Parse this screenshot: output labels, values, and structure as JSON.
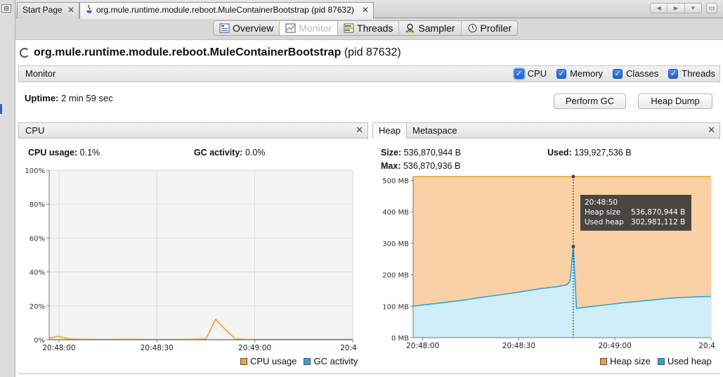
{
  "tabs": [
    {
      "label": "Start Page"
    },
    {
      "label": "org.mule.runtime.module.reboot.MuleContainerBootstrap (pid 87632)"
    }
  ],
  "subnav": [
    {
      "label": "Overview",
      "icon": "overview-icon"
    },
    {
      "label": "Monitor",
      "icon": "monitor-icon"
    },
    {
      "label": "Threads",
      "icon": "threads-icon"
    },
    {
      "label": "Sampler",
      "icon": "sampler-icon"
    },
    {
      "label": "Profiler",
      "icon": "profiler-icon"
    }
  ],
  "process": {
    "name": "org.mule.runtime.module.reboot.MuleContainerBootstrap",
    "pid": "(pid 87632)"
  },
  "monitor": {
    "label": "Monitor",
    "checks": [
      {
        "label": "CPU",
        "checked": true
      },
      {
        "label": "Memory",
        "checked": true
      },
      {
        "label": "Classes",
        "checked": true
      },
      {
        "label": "Threads",
        "checked": true
      }
    ],
    "uptime_label": "Uptime:",
    "uptime_value": "2 min 59 sec",
    "perform_gc": "Perform GC",
    "heap_dump": "Heap Dump"
  },
  "cpu_panel": {
    "title": "CPU",
    "cpu_usage_label": "CPU usage:",
    "cpu_usage_value": "0.1%",
    "gc_label": "GC activity:",
    "gc_value": "0.0%",
    "legend": [
      {
        "label": "CPU usage",
        "color": "#f0a030"
      },
      {
        "label": "GC activity",
        "color": "#2ea3d8"
      }
    ]
  },
  "heap_panel": {
    "tabs": [
      "Heap",
      "Metaspace"
    ],
    "size_label": "Size:",
    "size_value": "536,870,944 B",
    "max_label": "Max:",
    "max_value": "536,870,936 B",
    "used_label": "Used:",
    "used_value": "139,927,536 B",
    "tooltip": {
      "time": "20:48:50",
      "heap_size_label": "Heap size",
      "heap_size_value": "536,870,944 B",
      "used_heap_label": "Used heap",
      "used_heap_value": "302,981,112 B"
    },
    "legend": [
      {
        "label": "Heap size",
        "color": "#f0a030"
      },
      {
        "label": "Used heap",
        "color": "#2ea3d8"
      }
    ]
  },
  "chart_data": [
    {
      "type": "line",
      "name": "cpu",
      "ylim": [
        0,
        100
      ],
      "yticks": [
        "0%",
        "20%",
        "40%",
        "60%",
        "80%",
        "100%"
      ],
      "xticks": [
        "20:48:00",
        "20:48:30",
        "20:49:00",
        "20:4"
      ],
      "x_seconds": [
        0,
        3,
        6,
        9,
        12,
        15,
        18,
        21,
        24,
        27,
        30,
        33,
        36,
        39,
        42,
        45,
        48,
        51,
        54,
        57,
        60,
        63,
        66,
        69,
        72,
        75,
        78,
        81,
        84,
        87,
        90,
        93
      ],
      "series": [
        {
          "name": "CPU usage",
          "color": "#f0a030",
          "values": [
            1,
            2,
            0.5,
            0.3,
            0.2,
            0.2,
            0.2,
            0.2,
            0.3,
            0.2,
            0.2,
            0.2,
            0.2,
            0.2,
            0.2,
            0.3,
            0.5,
            12,
            6,
            0.5,
            0.2,
            0.2,
            0.2,
            0.2,
            0.2,
            0.2,
            0.2,
            0.2,
            0.2,
            0.2,
            0.2,
            0.2
          ]
        },
        {
          "name": "GC activity",
          "color": "#2ea3d8",
          "values": [
            0,
            0,
            0,
            0,
            0,
            0,
            0,
            0,
            0,
            0,
            0,
            0,
            0,
            0,
            0,
            0,
            0,
            0,
            0,
            0,
            0,
            0,
            0,
            0,
            0,
            0,
            0,
            0,
            0,
            0,
            0,
            0
          ]
        }
      ]
    },
    {
      "type": "area",
      "name": "heap",
      "ylim": [
        0,
        512
      ],
      "yunits": "MB",
      "yticks": [
        "0 MB",
        "100 MB",
        "200 MB",
        "300 MB",
        "400 MB",
        "500 MB"
      ],
      "xticks": [
        "20:48:00",
        "20:48:30",
        "20:49:00",
        "20:4"
      ],
      "x_seconds": [
        0,
        5,
        10,
        15,
        20,
        25,
        30,
        35,
        40,
        45,
        48,
        49,
        50,
        51,
        55,
        60,
        65,
        70,
        75,
        80,
        85,
        90,
        93
      ],
      "series": [
        {
          "name": "Heap size",
          "color": "#f0a030",
          "values": [
            512,
            512,
            512,
            512,
            512,
            512,
            512,
            512,
            512,
            512,
            512,
            512,
            512,
            512,
            512,
            512,
            512,
            512,
            512,
            512,
            512,
            512,
            512
          ]
        },
        {
          "name": "Used heap",
          "color": "#2ea3d8",
          "values": [
            100,
            106,
            112,
            118,
            126,
            133,
            140,
            148,
            156,
            162,
            168,
            180,
            289,
            93,
            98,
            104,
            110,
            115,
            120,
            125,
            128,
            130,
            131
          ]
        }
      ]
    }
  ]
}
